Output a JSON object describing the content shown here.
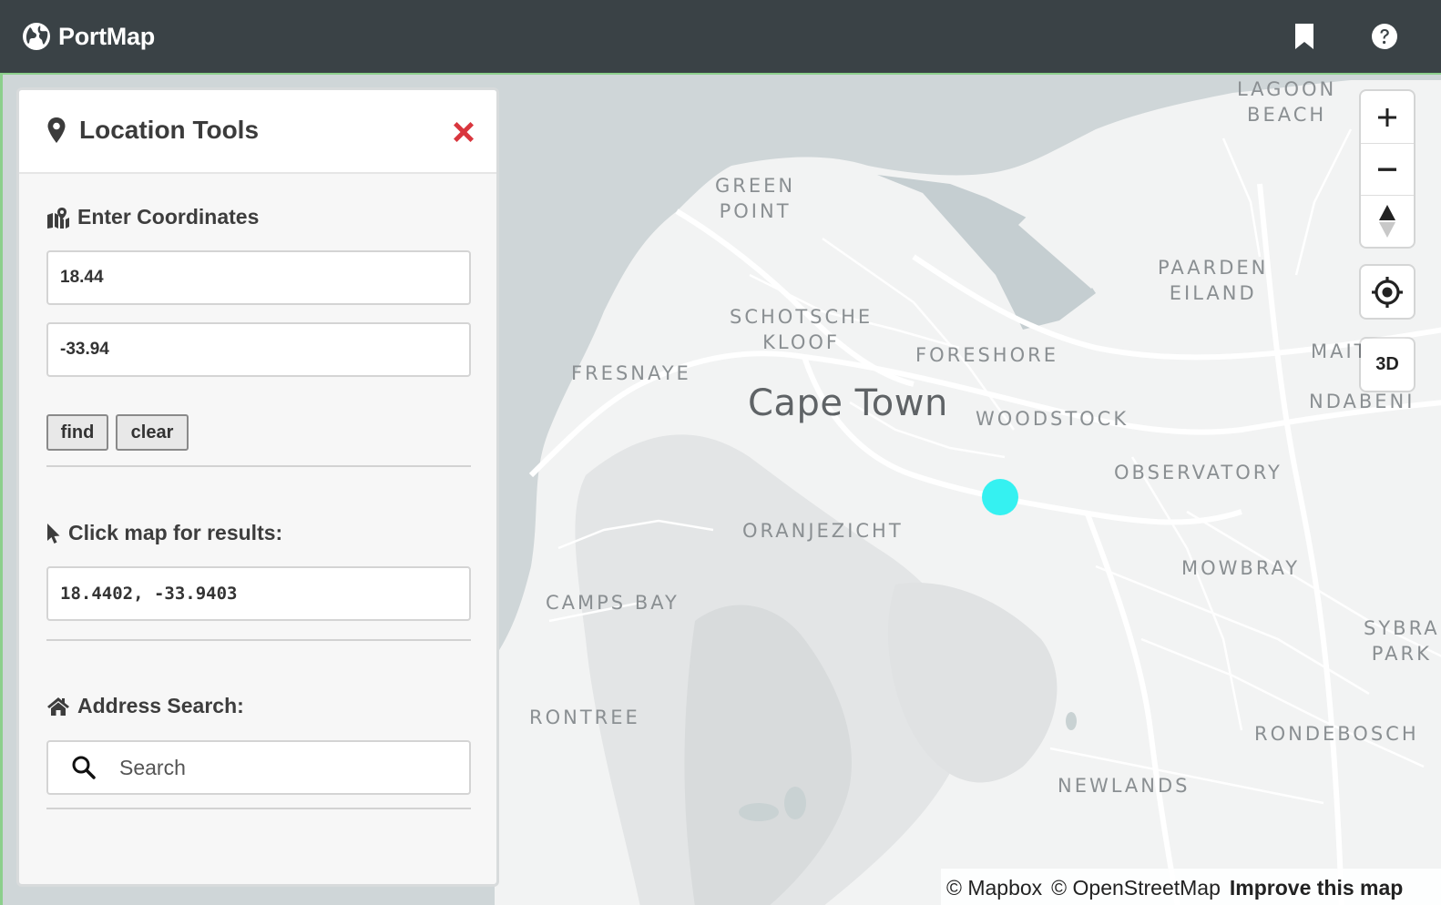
{
  "app": {
    "title": "PortMap"
  },
  "panel": {
    "title": "Location Tools",
    "coordinates": {
      "heading": "Enter Coordinates",
      "longitude_value": "18.44",
      "latitude_value": "-33.94",
      "find_label": "find",
      "clear_label": "clear"
    },
    "click_results": {
      "heading": "Click map for results:",
      "value": "18.4402, -33.9403"
    },
    "address_search": {
      "heading": "Address Search:",
      "placeholder": "Search"
    }
  },
  "map": {
    "city_label": "Cape Town",
    "place_labels": {
      "lagoon_beach": "LAGOON\nBEACH",
      "green_point": "GREEN\nPOINT",
      "paarden_eiland": "PAARDEN\nEILAND",
      "schotsche_kloof": "SCHOTSCHE\nKLOOF",
      "foreshore": "FORESHORE",
      "fresnaye": "FRESNAYE",
      "maitland": "MAIT",
      "ndabeni": "NDABENI",
      "woodstock": "WOODSTOCK",
      "observatory": "OBSERVATORY",
      "oranjezicht": "ORANJEZICHT",
      "mowbray": "MOWBRAY",
      "camps_bay": "CAMPS BAY",
      "sybrand_park": "SYBRA\nPARK",
      "rontree": "RONTREE",
      "rondebosch": "RONDEBOSCH",
      "newlands": "NEWLANDS"
    },
    "controls": {
      "zoom_in_icon": "plus-icon",
      "zoom_out_icon": "minus-icon",
      "compass_icon": "compass-icon",
      "locate_icon": "crosshair-icon",
      "d3_label": "3D"
    },
    "marker_color": "#35f1f1",
    "attribution": {
      "mapbox": "© Mapbox",
      "osm": "© OpenStreetMap",
      "improve": "Improve this map"
    }
  },
  "colors": {
    "topbar": "#3a4246",
    "close": "#d9363e",
    "accent_border": "#8ccf8c"
  }
}
